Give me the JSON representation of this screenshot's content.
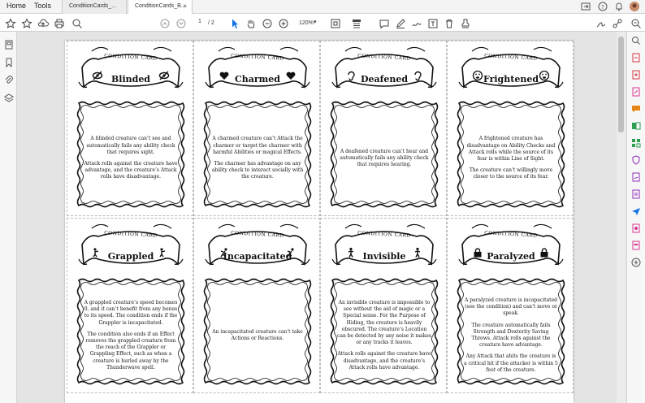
{
  "menu": {
    "home": "Home",
    "tools": "Tools"
  },
  "tabs": [
    {
      "label": "ConditionCards_..."
    },
    {
      "label": "ConditionCards_B..."
    }
  ],
  "toolbar": {
    "page_current": "1",
    "page_total": "/ 2",
    "zoom": "120%"
  },
  "card_header": "CONDITION CARD",
  "cards": [
    {
      "title": "Blinded",
      "icon": "blind-eye-icon",
      "body": [
        "A blinded creature can’t see and automatically fails any ability check that requires sight.",
        "Attack rolls against the creature have advantage, and the creature’s Attack rolls have disadvantage."
      ]
    },
    {
      "title": "Charmed",
      "icon": "heart-icon",
      "body": [
        "A charmed creature can’t Attack the charmer or target the charmer with harmful Abilities or magical Effects.",
        "The charmer has advantage on any ability check to interact socially with the creature."
      ]
    },
    {
      "title": "Deafened",
      "icon": "ear-icon",
      "body": [
        "A deafened creature can’t hear and automatically fails any ability check that requires hearing."
      ]
    },
    {
      "title": "Frightened",
      "icon": "scared-face-icon",
      "body": [
        "A frightened creature has disadvantage on Ability Checks and Attack rolls while the source of its fear is within Line of Sight.",
        "The creature can’t willingly move closer to the source of its fear."
      ]
    },
    {
      "title": "Grappled",
      "icon": "grapple-figure-icon",
      "body": [
        "A grappled creature’s speed becomes 0, and it can’t benefit from any bonus to its speed. The condition ends if the Grappler is incapacitated.",
        "The condition also ends if an Effect removes the grappled creature from the reach of the Grappler or Grappling Effect, such as when a creature is hurled away by the Thunderwave spell."
      ]
    },
    {
      "title": "Incapacitated",
      "icon": "falling-figure-icon",
      "body": [
        "An incapacitated creature can’t take Actions or Reactions."
      ]
    },
    {
      "title": "Invisible",
      "icon": "walking-figure-icon",
      "body": [
        "An invisible creature is impossible to see without the aid of magic or a Special sense. For the Purpose of Hiding, the creature is heavily obscured. The creature’s Location can be detected by any noise it makes or any tracks it leaves.",
        "Attack rolls against the creature have disadvantage, and the creature’s Attack rolls have advantage."
      ]
    },
    {
      "title": "Paralyzed",
      "icon": "padlock-icon",
      "body": [
        "A paralyzed creature is incapacitated (see the condition) and can’t move or speak.",
        "The creature automatically fails Strength and Dexterity Saving Throws. Attack rolls against the creature have advantage.",
        "Any Attack that ahits the creature is a critical hit if the attacker is within 5 feet of the creature."
      ]
    }
  ],
  "colors": {
    "accent_blue": "#1473e6",
    "red": "#d7373f",
    "purple": "#8f2fb5",
    "green": "#2d9d4f",
    "orange": "#e68619",
    "pink": "#d83790"
  }
}
